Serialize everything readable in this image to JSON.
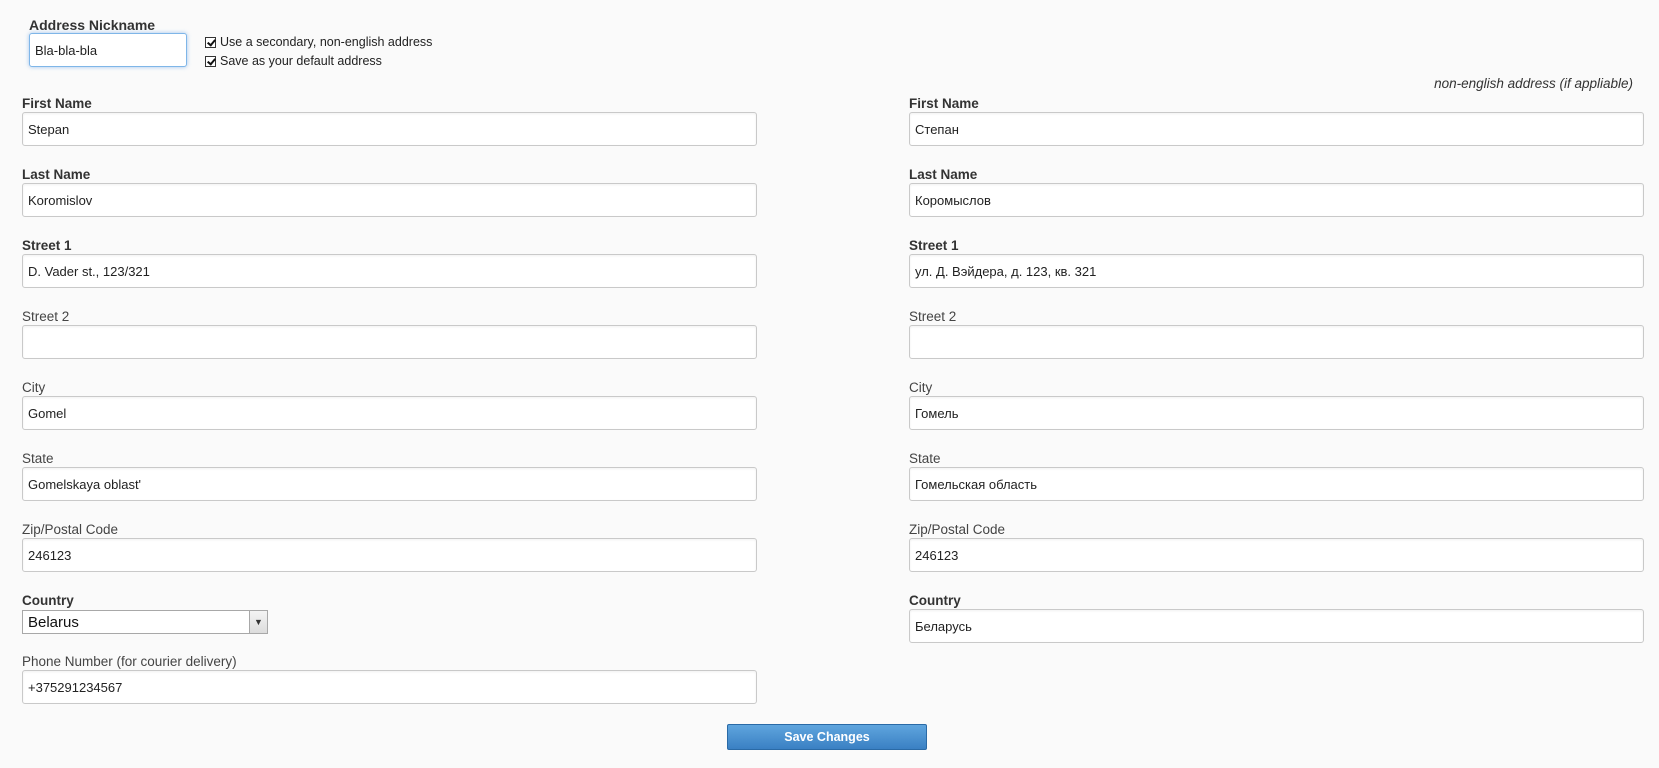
{
  "nickname": {
    "label": "Address Nickname",
    "value": "Bla-bla-bla"
  },
  "options": {
    "secondary_label": "Use a secondary, non-english address",
    "default_label": "Save as your default address"
  },
  "note": "non-english address (if appliable)",
  "primary": {
    "first_name": {
      "label": "First Name",
      "value": "Stepan"
    },
    "last_name": {
      "label": "Last Name",
      "value": "Koromislov"
    },
    "street1": {
      "label": "Street 1",
      "value": "D. Vader st., 123/321"
    },
    "street2": {
      "label": "Street 2",
      "value": ""
    },
    "city": {
      "label": "City",
      "value": "Gomel"
    },
    "state": {
      "label": "State",
      "value": "Gomelskaya oblast'"
    },
    "zip": {
      "label": "Zip/Postal Code",
      "value": "246123"
    },
    "country": {
      "label": "Country",
      "value": "Belarus"
    },
    "phone": {
      "label": "Phone Number (for courier delivery)",
      "value": "+375291234567"
    }
  },
  "secondary": {
    "first_name": {
      "label": "First Name",
      "value": "Степан"
    },
    "last_name": {
      "label": "Last Name",
      "value": "Коромыслов"
    },
    "street1": {
      "label": "Street 1",
      "value": "ул. Д. Вэйдера, д. 123, кв. 321"
    },
    "street2": {
      "label": "Street 2",
      "value": ""
    },
    "city": {
      "label": "City",
      "value": "Гомель"
    },
    "state": {
      "label": "State",
      "value": "Гомельская область"
    },
    "zip": {
      "label": "Zip/Postal Code",
      "value": "246123"
    },
    "country": {
      "label": "Country",
      "value": "Беларусь"
    }
  },
  "save_label": "Save Changes"
}
